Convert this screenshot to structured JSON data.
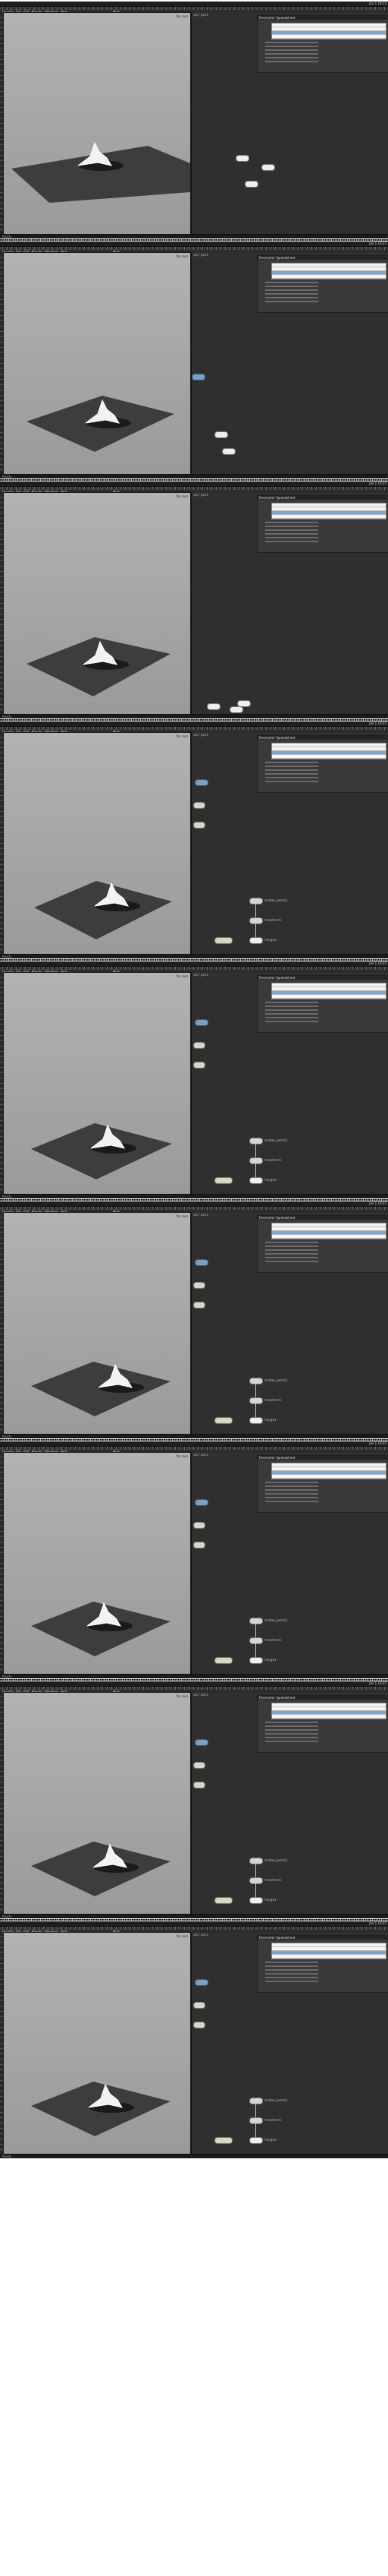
{
  "app": {
    "menu_items": [
      "Houdini",
      "File",
      "Edit",
      "Render",
      "Windows",
      "Help"
    ],
    "desktop": "Main",
    "clock": "Jan 1 19:25"
  },
  "viewport": {
    "camera_label": "No cam",
    "background": "#a8a8a8"
  },
  "network": {
    "path_label": "obj / geo1",
    "param_window_title": "Parameter Spreadsheet"
  },
  "status": "Ready",
  "frames": [
    {
      "nodes": [
        {
          "label": "",
          "style": "white"
        },
        {
          "label": "",
          "style": "white"
        },
        {
          "label": "",
          "style": "white"
        }
      ]
    },
    {
      "nodes": [
        {
          "label": "",
          "style": "blue"
        },
        {
          "label": "",
          "style": "white"
        },
        {
          "label": "",
          "style": "white"
        }
      ]
    },
    {
      "nodes": [
        {
          "label": "",
          "style": "white"
        },
        {
          "label": "",
          "style": "white"
        },
        {
          "label": "",
          "style": "white"
        }
      ]
    },
    {
      "nodes": [
        {
          "label": "",
          "style": "blue"
        },
        {
          "label": "scatter_points1",
          "style": "tan"
        },
        {
          "label": "transform1",
          "style": "tan"
        },
        {
          "label": "merge1",
          "style": "white"
        }
      ]
    },
    {
      "nodes": [
        {
          "label": "",
          "style": "blue"
        },
        {
          "label": "scatter_points1",
          "style": "tan"
        },
        {
          "label": "transform1",
          "style": "tan"
        },
        {
          "label": "merge1",
          "style": "white"
        }
      ]
    },
    {
      "nodes": [
        {
          "label": "",
          "style": "blue"
        },
        {
          "label": "scatter_points1",
          "style": "tan"
        },
        {
          "label": "transform1",
          "style": "tan"
        },
        {
          "label": "merge1",
          "style": "white"
        }
      ]
    },
    {
      "nodes": [
        {
          "label": "",
          "style": "blue"
        },
        {
          "label": "scatter_points1",
          "style": "tan"
        },
        {
          "label": "transform1",
          "style": "tan"
        },
        {
          "label": "merge1",
          "style": "white"
        }
      ]
    },
    {
      "nodes": [
        {
          "label": "",
          "style": "blue"
        },
        {
          "label": "scatter_points1",
          "style": "tan"
        },
        {
          "label": "transform1",
          "style": "tan"
        },
        {
          "label": "merge1",
          "style": "white"
        }
      ]
    },
    {
      "nodes": [
        {
          "label": "",
          "style": "blue"
        },
        {
          "label": "scatter_points1",
          "style": "tan"
        },
        {
          "label": "transform1",
          "style": "tan"
        },
        {
          "label": "merge1",
          "style": "white"
        }
      ]
    }
  ]
}
